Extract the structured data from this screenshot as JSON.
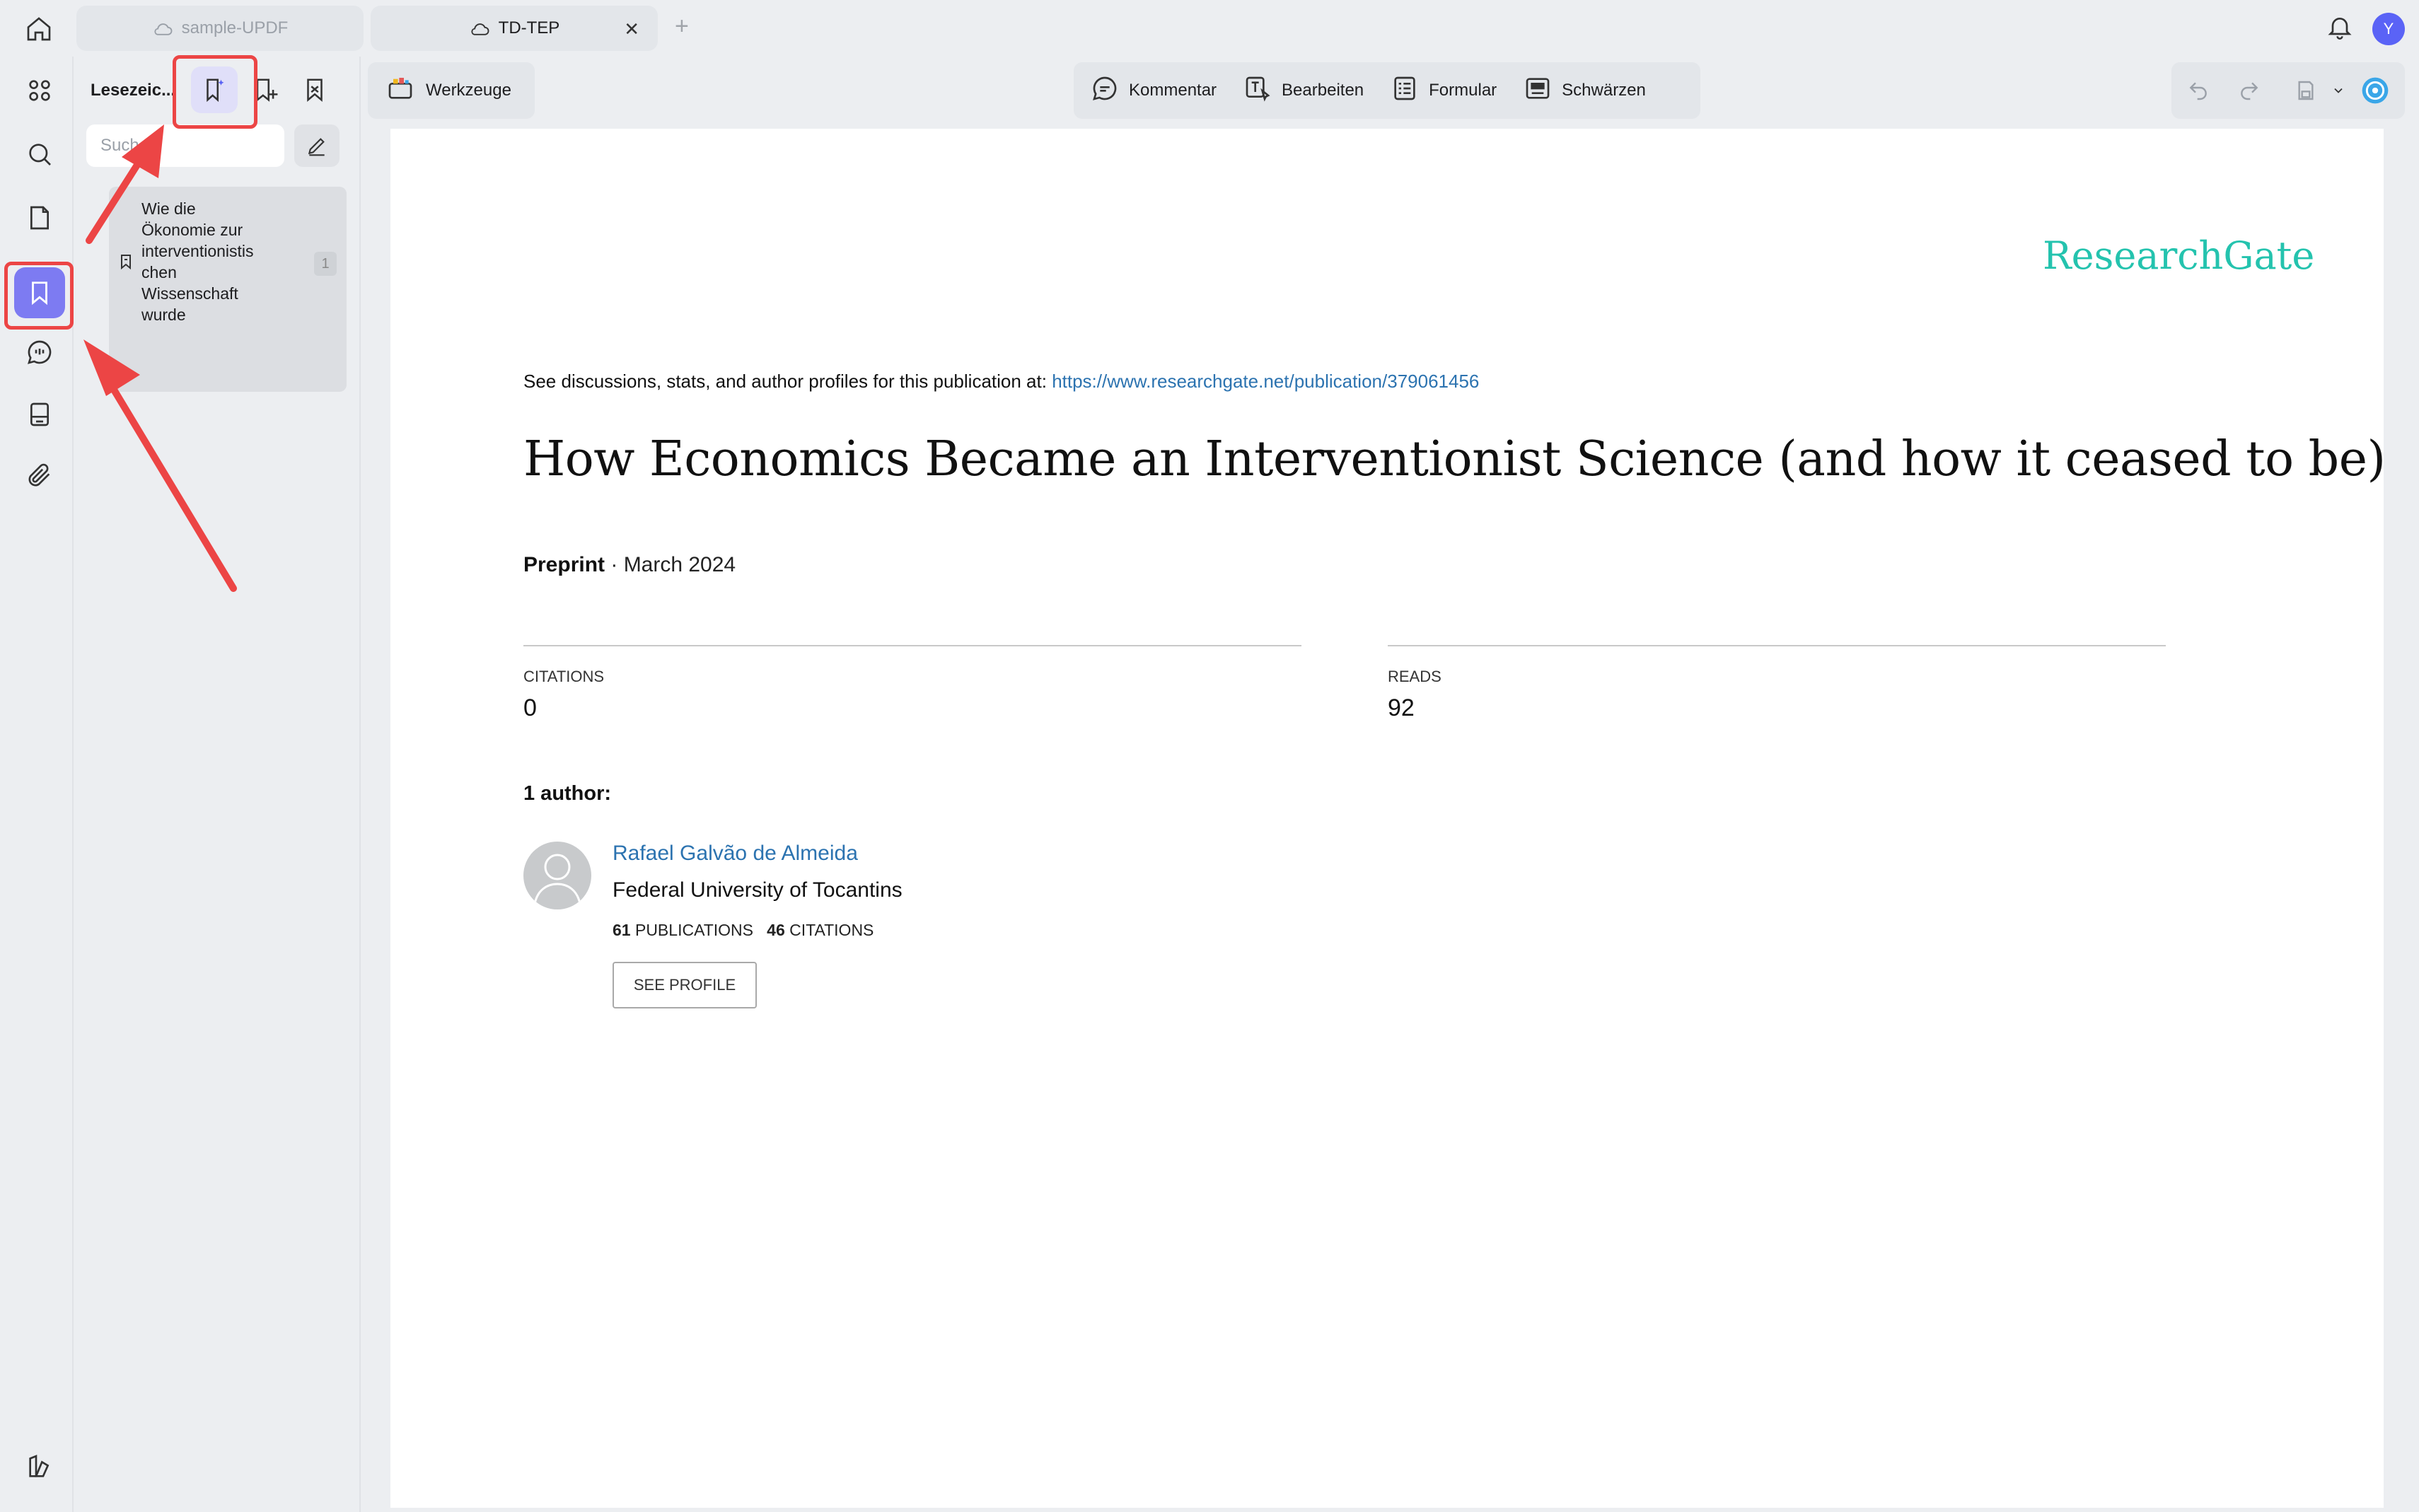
{
  "tabs": [
    {
      "label": "sample-UPDF",
      "active": false
    },
    {
      "label": "TD-TEP",
      "active": true
    }
  ],
  "user": {
    "initial": "Y",
    "color": "#5a63f6"
  },
  "sidebar": {
    "title": "Lesezeic...",
    "search_placeholder": "Suchen",
    "bookmarks": [
      {
        "label": "Wie die\nÖkonomie zur\ninterventionistis\nchen\nWissenschaft\nwurde",
        "page": "1"
      }
    ]
  },
  "toolbar": {
    "tools_label": "Werkzeuge",
    "items": [
      {
        "label": "Kommentar",
        "icon": "comment-icon"
      },
      {
        "label": "Bearbeiten",
        "icon": "edit-text-icon"
      },
      {
        "label": "Formular",
        "icon": "form-icon"
      },
      {
        "label": "Schwärzen",
        "icon": "redact-icon"
      }
    ]
  },
  "document": {
    "brand": "ResearchGate",
    "see_text": "See discussions, stats, and author profiles for this publication at: ",
    "url": "https://www.researchgate.net/publication/379061456",
    "title": "How Economics Became an Interventionist Science (and how it ceased to be)",
    "type": "Preprint",
    "date": " · March 2024",
    "citations_label": "CITATIONS",
    "citations_value": "0",
    "reads_label": "READS",
    "reads_value": "92",
    "authors_heading": "1 author:",
    "author": {
      "name": "Rafael Galvão de Almeida",
      "institution": "Federal University of Tocantins",
      "publications_count": "61",
      "publications_label": "PUBLICATIONS",
      "citations_count": "46",
      "citations_label": "CITATIONS",
      "profile_button": "SEE PROFILE"
    }
  },
  "colors": {
    "accent": "#7d7bf2",
    "highlight": "#ec4545",
    "brand": "#24c3ae",
    "link": "#2c73b0"
  }
}
